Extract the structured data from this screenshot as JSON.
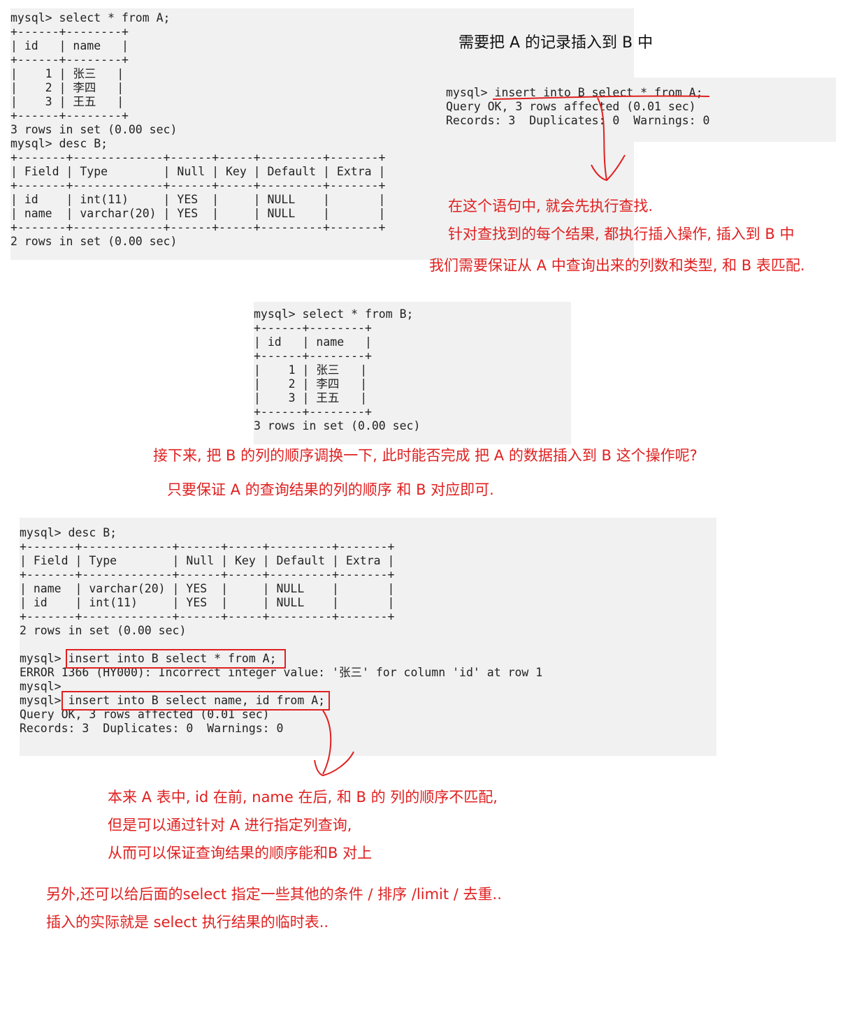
{
  "terminal1": {
    "lines": [
      "mysql> select * from A;",
      "+------+--------+",
      "| id   | name   |",
      "+------+--------+",
      "|    1 | 张三   |",
      "|    2 | 李四   |",
      "|    3 | 王五   |",
      "+------+--------+",
      "3 rows in set (0.00 sec)",
      "mysql> desc B;",
      "+-------+-------------+------+-----+---------+-------+",
      "| Field | Type        | Null | Key | Default | Extra |",
      "+-------+-------------+------+-----+---------+-------+",
      "| id    | int(11)     | YES  |     | NULL    |       |",
      "| name  | varchar(20) | YES  |     | NULL    |       |",
      "+-------+-------------+------+-----+---------+-------+",
      "2 rows in set (0.00 sec)"
    ]
  },
  "terminal2": {
    "lines": [
      "mysql> insert into B select * from A;",
      "Query OK, 3 rows affected (0.01 sec)",
      "Records: 3  Duplicates: 0  Warnings: 0"
    ]
  },
  "terminal3": {
    "lines": [
      "mysql> select * from B;",
      "+------+--------+",
      "| id   | name   |",
      "+------+--------+",
      "|    1 | 张三   |",
      "|    2 | 李四   |",
      "|    3 | 王五   |",
      "+------+--------+",
      "3 rows in set (0.00 sec)"
    ]
  },
  "terminal4": {
    "lines": [
      "mysql> desc B;",
      "+-------+-------------+------+-----+---------+-------+",
      "| Field | Type        | Null | Key | Default | Extra |",
      "+-------+-------------+------+-----+---------+-------+",
      "| name  | varchar(20) | YES  |     | NULL    |       |",
      "| id    | int(11)     | YES  |     | NULL    |       |",
      "+-------+-------------+------+-----+---------+-------+",
      "2 rows in set (0.00 sec)",
      "",
      "mysql> insert into B select * from A;",
      "ERROR 1366 (HY000): Incorrect integer value: '张三' for column 'id' at row 1",
      "mysql>",
      "mysql> insert into B select name, id from A;",
      "Query OK, 3 rows affected (0.01 sec)",
      "Records: 3  Duplicates: 0  Warnings: 0"
    ]
  },
  "notes": {
    "title": "需要把 A 的记录插入到 B 中",
    "n1": "在这个语句中, 就会先执行查找.",
    "n2": "针对查找到的每个结果, 都执行插入操作, 插入到 B 中",
    "n3": "我们需要保证从 A 中查询出来的列数和类型, 和 B 表匹配.",
    "n4": "接下来, 把 B 的列的顺序调换一下, 此时能否完成 把 A 的数据插入到 B 这个操作呢?",
    "n5": "只要保证 A 的查询结果的列的顺序 和 B 对应即可.",
    "n6": "本来 A 表中, id 在前, name 在后, 和 B 的 列的顺序不匹配,",
    "n7": "但是可以通过针对 A 进行指定列查询,",
    "n8": "从而可以保证查询结果的顺序能和B 对上",
    "n9": "另外,还可以给后面的select 指定一些其他的条件 / 排序 /limit / 去重..",
    "n10": "插入的实际就是 select 执行结果的临时表.."
  },
  "colors": {
    "annotation": "#e02020",
    "terminal_bg": "#f1f1f1"
  }
}
